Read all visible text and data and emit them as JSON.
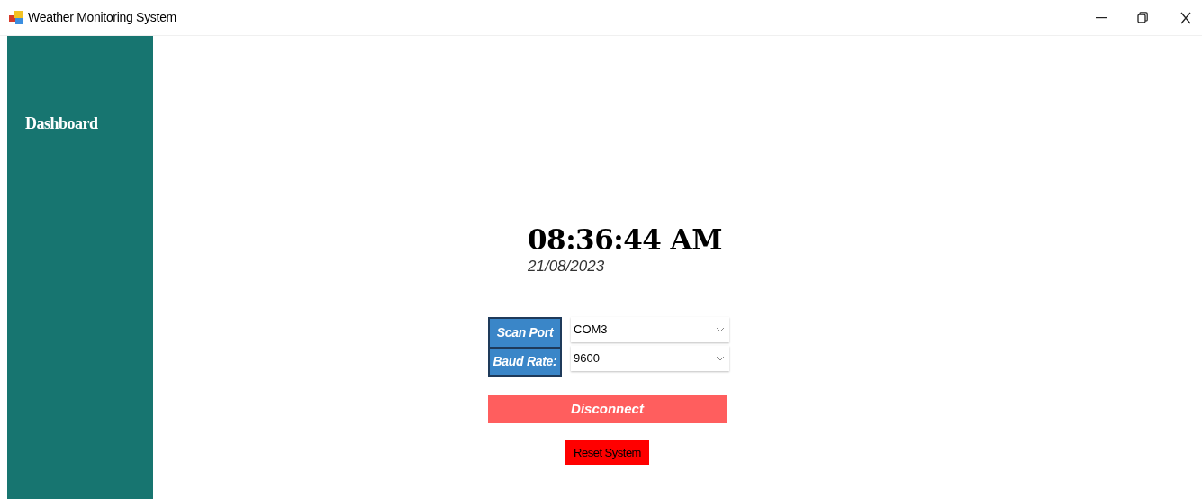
{
  "window": {
    "title": "Weather Monitoring System"
  },
  "sidebar": {
    "items": [
      {
        "label": "Dashboard"
      }
    ]
  },
  "clock": {
    "time": "08:36:44 AM",
    "date": "21/08/2023"
  },
  "connection": {
    "fields": [
      {
        "label": "Scan Port",
        "value": "COM3"
      },
      {
        "label": "Baud Rate:",
        "value": "9600"
      }
    ],
    "connect_button": "Disconnect",
    "reset_button": "Reset System"
  }
}
